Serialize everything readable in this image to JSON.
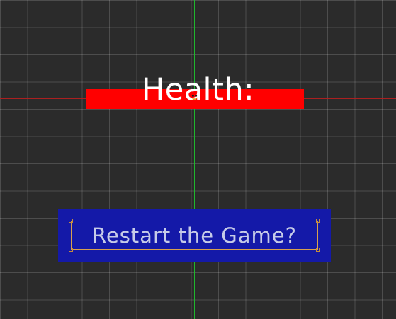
{
  "scene": {
    "health_label": "Health:",
    "restart_label": "Restart the Game?"
  },
  "colors": {
    "background": "#2b2b2b",
    "grid": "#4a4a4a",
    "y_axis": "#1fbf2d",
    "x_axis": "#b22020",
    "health_bar": "#ff0000",
    "restart_panel": "#1419a8",
    "restart_border": "#d7a04f",
    "restart_text": "#c6cbe8"
  },
  "icons": {
    "pivot": "pivot-icon",
    "handles": "selection-handle-icon"
  }
}
